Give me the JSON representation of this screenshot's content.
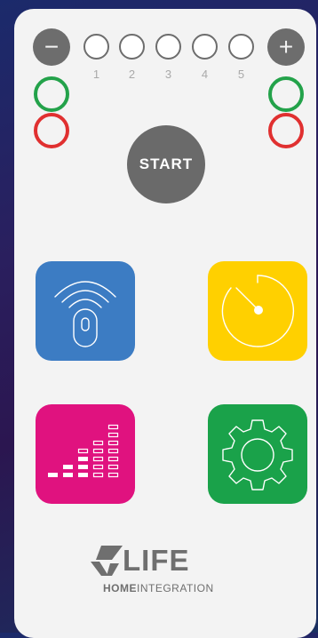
{
  "controls": {
    "minus_label": "−",
    "plus_label": "+",
    "start_label": "START"
  },
  "levels": [
    "1",
    "2",
    "3",
    "4",
    "5"
  ],
  "colors": {
    "blue_tile": "#3c7cc3",
    "yellow_tile": "#ffd000",
    "magenta_tile": "#e0127f",
    "green_tile": "#1aa24a",
    "ring_green": "#23a24a",
    "ring_red": "#e03030"
  },
  "tiles": {
    "remote": "remote-control-icon",
    "timer": "timer-icon",
    "equalizer": "equalizer-icon",
    "settings": "gear-icon"
  },
  "brand": {
    "name": "LIFE",
    "sub_bold": "HOME",
    "sub_rest": "INTEGRATION"
  }
}
